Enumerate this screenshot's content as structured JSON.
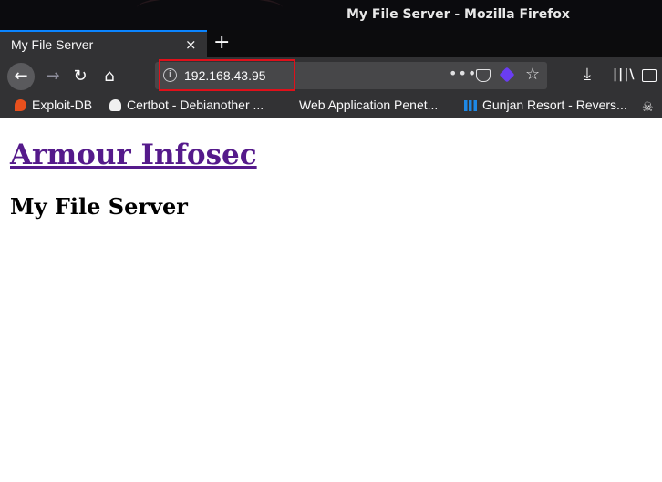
{
  "window": {
    "title": "My File Server - Mozilla Firefox"
  },
  "tabs": [
    {
      "label": "My File Server",
      "close_icon": "×"
    }
  ],
  "newtab_icon": "+",
  "nav": {
    "back_icon": "←",
    "forward_icon": "→",
    "reload_icon": "↻",
    "home_icon": "⌂",
    "url": "192.168.43.95",
    "info_icon": "i",
    "page_actions_icon": "•••",
    "bookmark_star_icon": "☆",
    "download_icon": "⤓",
    "library_icon": "|||\\"
  },
  "bookmarks": [
    {
      "label": "Exploit-DB"
    },
    {
      "label": "Certbot - Debianother ..."
    },
    {
      "label": "Web Application Penet..."
    },
    {
      "label": "Gunjan Resort - Revers..."
    },
    {
      "label": "☠"
    }
  ],
  "page": {
    "heading_link": "Armour Infosec",
    "subheading": "My File Server"
  },
  "colors": {
    "highlight": "#e0101a",
    "tab_accent": "#0a84ff",
    "visited_link": "#551a8b"
  }
}
